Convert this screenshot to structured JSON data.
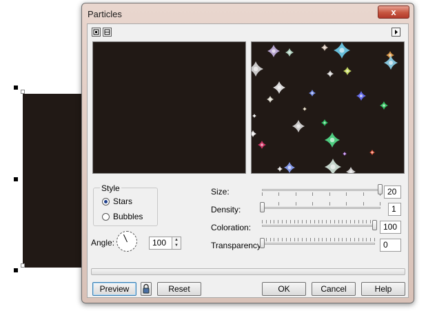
{
  "dialog": {
    "title": "Particles",
    "close_glyph": "x"
  },
  "icons": {
    "close": "close-icon",
    "view_single": "single-preview-icon",
    "view_split": "split-preview-icon",
    "expand": "expand-arrow-icon",
    "lock": "lock-icon",
    "dial": "angle-dial-icon"
  },
  "colors": {
    "preview_background": "#211915",
    "close_button": "#c6553f"
  },
  "style_group": {
    "label": "Style",
    "options": [
      {
        "label": "Stars",
        "selected": true
      },
      {
        "label": "Bubbles",
        "selected": false
      }
    ]
  },
  "angle": {
    "label": "Angle:",
    "value": "100"
  },
  "sliders": [
    {
      "label": "Size:",
      "value": "20",
      "fraction": 1.0
    },
    {
      "label": "Density:",
      "value": "1",
      "fraction": 0.0
    },
    {
      "label": "Coloration:",
      "value": "100",
      "fraction": 1.0
    },
    {
      "label": "Transparency:",
      "value": "0",
      "fraction": 0.0
    }
  ],
  "buttons": {
    "preview": "Preview",
    "reset": "Reset",
    "ok": "OK",
    "cancel": "Cancel",
    "help": "Help"
  }
}
